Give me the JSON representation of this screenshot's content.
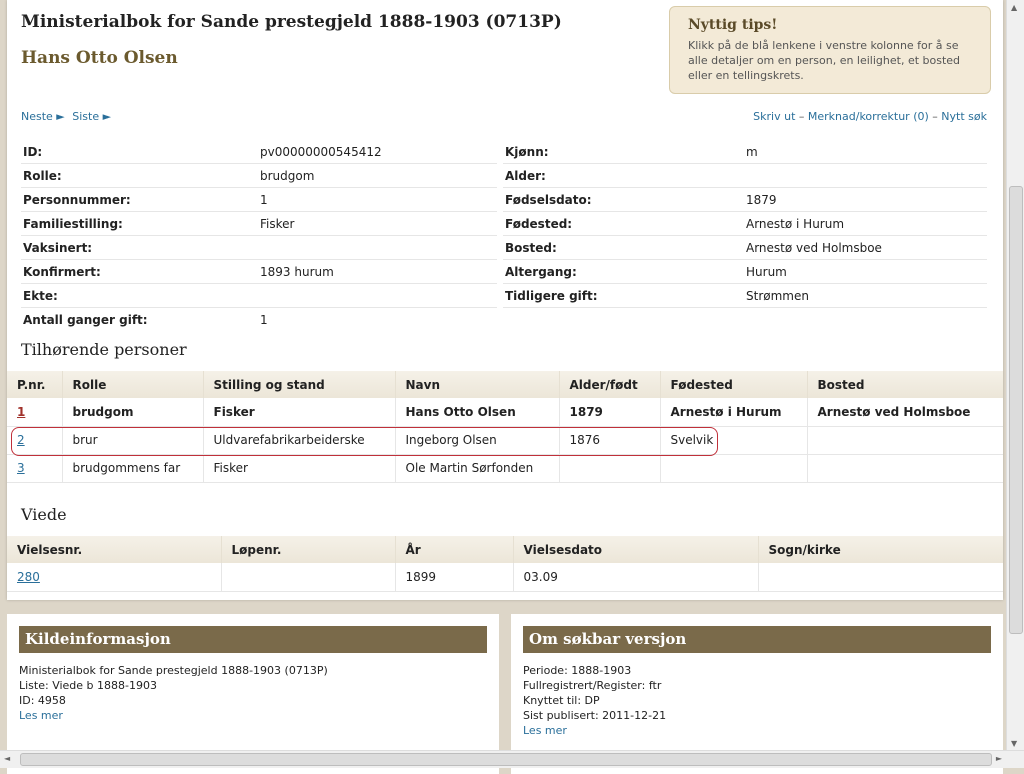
{
  "header": {
    "title": "Ministerialbok for Sande prestegjeld 1888-1903 (0713P)",
    "person": "Hans Otto Olsen"
  },
  "tips": {
    "title": "Nyttig tips!",
    "body": "Klikk på de blå lenkene i venstre kolonne for å se alle detaljer om en person, en leilighet, et bosted eller en tellingskrets."
  },
  "nav": {
    "next": "Neste ►",
    "last": "Siste ►",
    "print": "Skriv ut",
    "remark": "Merknad/korrektur (0)",
    "new_search": "Nytt søk",
    "sep": "–"
  },
  "details": [
    {
      "l1": "ID:",
      "v1": "pv00000000545412",
      "l2": "Kjønn:",
      "v2": "m"
    },
    {
      "l1": "Rolle:",
      "v1": "brudgom",
      "l2": "Alder:",
      "v2": ""
    },
    {
      "l1": "Personnummer:",
      "v1": "1",
      "l2": "Fødselsdato:",
      "v2": "1879"
    },
    {
      "l1": "Familiestilling:",
      "v1": "Fisker",
      "l2": "Fødested:",
      "v2": "Arnestø i Hurum"
    },
    {
      "l1": "Vaksinert:",
      "v1": "",
      "l2": "Bosted:",
      "v2": "Arnestø ved Holmsboe"
    },
    {
      "l1": "Konfirmert:",
      "v1": "1893 hurum",
      "l2": "Altergang:",
      "v2": "Hurum"
    },
    {
      "l1": "Ekte:",
      "v1": "",
      "l2": "Tidligere gift:",
      "v2": "Strømmen"
    },
    {
      "l1": "Antall ganger gift:",
      "v1": "1"
    }
  ],
  "related": {
    "title": "Tilhørende personer",
    "headers": [
      "P.nr.",
      "Rolle",
      "Stilling og stand",
      "Navn",
      "Alder/født",
      "Fødested",
      "Bosted"
    ],
    "rows": [
      [
        "1",
        "brudgom",
        "Fisker",
        "Hans Otto Olsen",
        "1879",
        "Arnestø i Hurum",
        "Arnestø ved Holmsboe"
      ],
      [
        "2",
        "brur",
        "Uldvarefabrikarbeiderske",
        "Ingeborg Olsen",
        "1876",
        "Svelvik",
        ""
      ],
      [
        "3",
        "brudgommens far",
        "Fisker",
        "Ole Martin Sørfonden",
        "",
        "",
        ""
      ]
    ]
  },
  "viede": {
    "title": "Viede",
    "headers": [
      "Vielsesnr.",
      "Løpenr.",
      "År",
      "Vielsesdato",
      "Sogn/kirke"
    ],
    "row": [
      "280",
      "",
      "1899",
      "03.09",
      ""
    ]
  },
  "kilde": {
    "title": "Kildeinformasjon",
    "lines": [
      "Ministerialbok for Sande prestegjeld 1888-1903 (0713P)",
      "Liste: Viede b 1888-1903",
      "ID: 4958"
    ],
    "more": "Les mer"
  },
  "om": {
    "title": "Om søkbar versjon",
    "lines": [
      "Periode: 1888-1903",
      "Fullregistrert/Register: ftr",
      "Knyttet til: DP",
      "Sist publisert: 2011-12-21"
    ],
    "more": "Les mer"
  }
}
